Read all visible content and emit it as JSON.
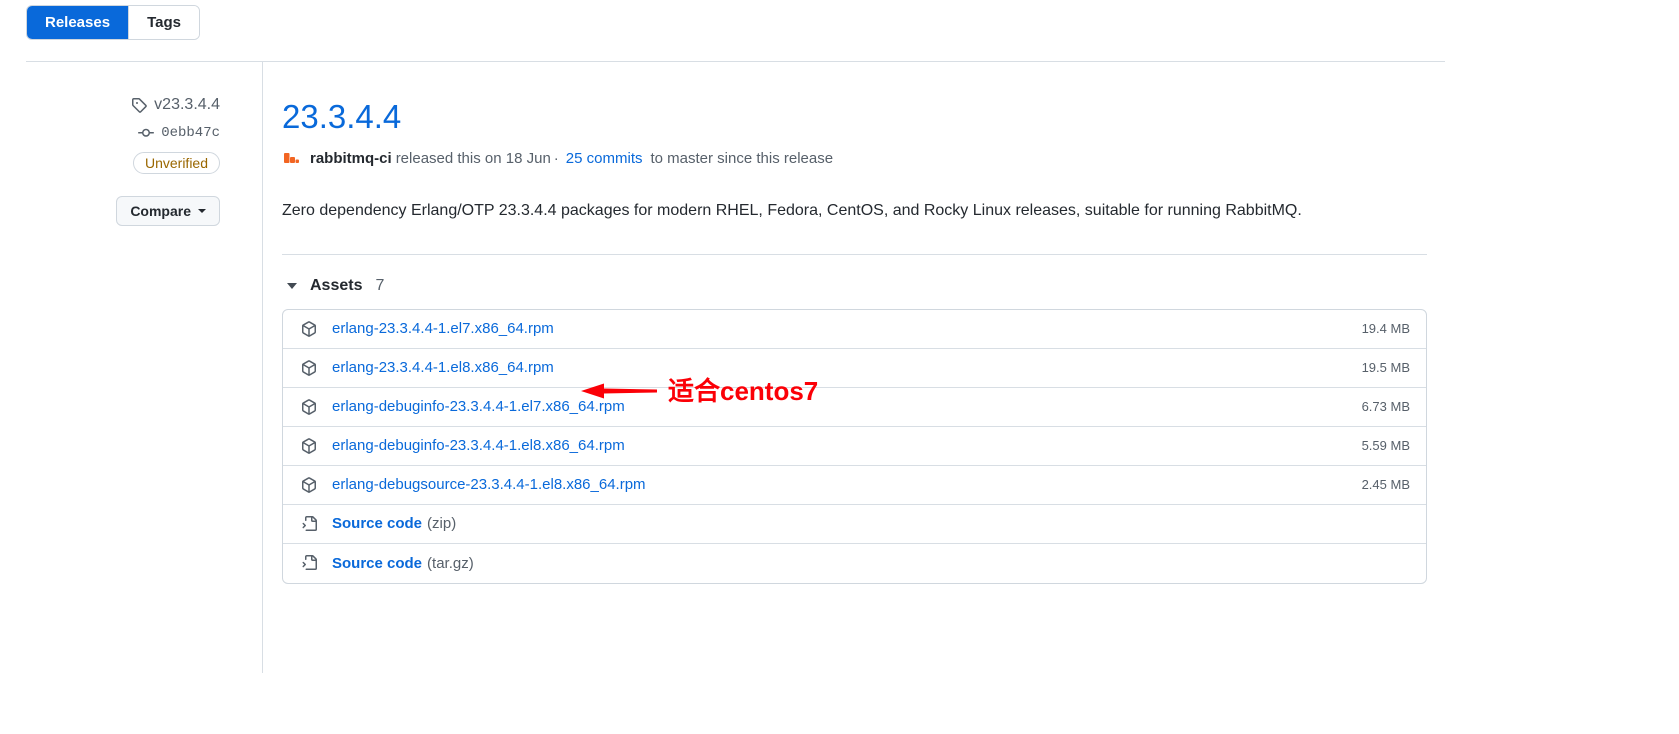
{
  "tabs": [
    {
      "label": "Releases",
      "active": true
    },
    {
      "label": "Tags",
      "active": false
    }
  ],
  "sidebar": {
    "tag_icon": "tag-icon",
    "tag_name": "v23.3.4.4",
    "commit_icon": "commit-icon",
    "commit_sha": "0ebb47c",
    "verification_badge": "Unverified",
    "compare_label": "Compare"
  },
  "release": {
    "title": "23.3.4.4",
    "avatar_icon": "user-avatar",
    "author": "rabbitmq-ci",
    "released_text": "released this on 18 Jun",
    "separator": "·",
    "commits_link": "25 commits",
    "tail_text": "to master since this release",
    "description": "Zero dependency Erlang/OTP 23.3.4.4 packages for modern RHEL, Fedora, CentOS, and Rocky Linux releases, suitable for running RabbitMQ."
  },
  "assets": {
    "header_label": "Assets",
    "count": "7",
    "rows": [
      {
        "icon": "package-icon",
        "name": "erlang-23.3.4.4-1.el7.x86_64.rpm",
        "suffix": "",
        "size": "19.4 MB",
        "bold": false
      },
      {
        "icon": "package-icon",
        "name": "erlang-23.3.4.4-1.el8.x86_64.rpm",
        "suffix": "",
        "size": "19.5 MB",
        "bold": false
      },
      {
        "icon": "package-icon",
        "name": "erlang-debuginfo-23.3.4.4-1.el7.x86_64.rpm",
        "suffix": "",
        "size": "6.73 MB",
        "bold": false
      },
      {
        "icon": "package-icon",
        "name": "erlang-debuginfo-23.3.4.4-1.el8.x86_64.rpm",
        "suffix": "",
        "size": "5.59 MB",
        "bold": false
      },
      {
        "icon": "package-icon",
        "name": "erlang-debugsource-23.3.4.4-1.el8.x86_64.rpm",
        "suffix": "",
        "size": "2.45 MB",
        "bold": false
      },
      {
        "icon": "file-code-icon",
        "name": "Source code",
        "suffix": "(zip)",
        "size": "",
        "bold": true
      },
      {
        "icon": "file-code-icon",
        "name": "Source code",
        "suffix": "(tar.gz)",
        "size": "",
        "bold": true
      }
    ]
  },
  "annotation": {
    "text": "适合centos7",
    "color": "#fb0007",
    "arrow_icon": "left-arrow-annotation"
  },
  "colors": {
    "link_blue": "#0969da",
    "active_tab_blue": "#0969da",
    "badge_amber": "#9a6700",
    "avatar_orange": "#f26522",
    "annotation_red": "#fb0007",
    "border_gray": "#d0d7de",
    "muted_text": "#57606a"
  }
}
